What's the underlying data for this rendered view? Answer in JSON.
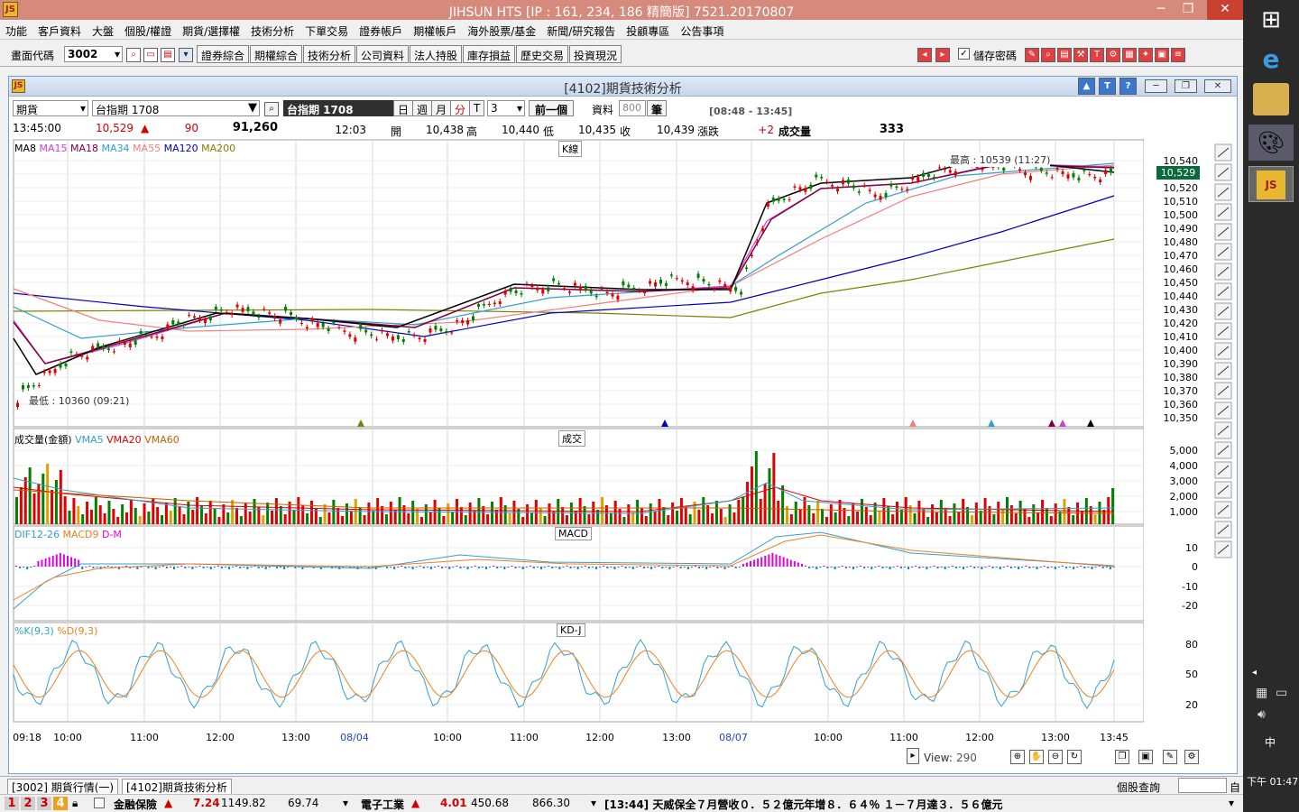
{
  "window": {
    "title": "JIHSUN HTS      [IP : 161, 234, 186 精簡版] 7521.20170807"
  },
  "menu": [
    "功能",
    "客戶資料",
    "大盤",
    "個股/權證",
    "期貨/選擇權",
    "技術分析",
    "下單交易",
    "證券帳戶",
    "期權帳戶",
    "海外股票/基金",
    "新聞/研究報告",
    "投顧專區",
    "公告事項"
  ],
  "toolbar": {
    "code_label": "畫面代碼",
    "code_value": "3002",
    "buttons": [
      "證券綜合",
      "期權綜合",
      "技術分析",
      "公司資料",
      "法人持股",
      "庫存損益",
      "歷史交易",
      "投資現況"
    ],
    "save_pw_label": "儲存密碼"
  },
  "mdi": {
    "title": "[4102]期貨技術分析",
    "type_select": "期貨",
    "symbol_select": "台指期 1708",
    "symbol_name": "台指期 1708",
    "periods": [
      "日",
      "週",
      "月",
      "分",
      "T"
    ],
    "interval": "3",
    "prev_label": "前一個",
    "data_label": "資料",
    "data_count": "800",
    "bars_label": "筆",
    "session_range": "[08:48 - 13:45]"
  },
  "quote": {
    "time": "13:45:00",
    "last": "10,529",
    "change": "90",
    "volume": "91,260",
    "bar_time": "12:03",
    "open_label": "開",
    "open": "10,438",
    "high_label": "高",
    "high": "10,440",
    "low_label": "低",
    "low": "10,435",
    "close_label": "收",
    "close": "10,439",
    "chg_label": "漲跌",
    "chg": "+2",
    "vol_label": "成交量",
    "vol": "333"
  },
  "panels": {
    "k": {
      "tag": "K線",
      "legend": [
        {
          "name": "MA8",
          "color": "#000000"
        },
        {
          "name": "MA15",
          "color": "#d040d0"
        },
        {
          "name": "MA18",
          "color": "#800040"
        },
        {
          "name": "MA34",
          "color": "#30a0d0"
        },
        {
          "name": "MA55",
          "color": "#f08080"
        },
        {
          "name": "MA120",
          "color": "#0000c0"
        },
        {
          "name": "MA200",
          "color": "#808000"
        }
      ],
      "high_note": "最高 : 10539 (11:27)",
      "low_note": "最低 : 10360 (09:21)",
      "last_badge": "10,529"
    },
    "vol": {
      "tag": "成交",
      "legend": [
        {
          "name": "成交量(金額)",
          "color": "#000000"
        },
        {
          "name": "VMA5",
          "color": "#30a0d0"
        },
        {
          "name": "VMA20",
          "color": "#e00000"
        },
        {
          "name": "VMA60",
          "color": "#c06000"
        }
      ]
    },
    "macd": {
      "tag": "MACD",
      "legend": [
        {
          "name": "DIF12-26",
          "color": "#30a0d0"
        },
        {
          "name": "MACD9",
          "color": "#f08020"
        },
        {
          "name": "D-M",
          "color": "#e000e0"
        }
      ]
    },
    "kd": {
      "tag": "KD-J",
      "legend": [
        {
          "name": "%K(9,3)",
          "color": "#30a0d0"
        },
        {
          "name": "%D(9,3)",
          "color": "#f08020"
        }
      ]
    }
  },
  "chart_data": [
    {
      "type": "line",
      "title": "K線",
      "yticks": [
        10540,
        10530,
        10520,
        10510,
        10500,
        10490,
        10480,
        10470,
        10460,
        10450,
        10440,
        10430,
        10420,
        10410,
        10400,
        10390,
        10380,
        10370,
        10360,
        10350
      ],
      "ylim": [
        10346,
        10550
      ],
      "series": [
        {
          "name": "MA8"
        },
        {
          "name": "MA15"
        },
        {
          "name": "MA18"
        },
        {
          "name": "MA34"
        },
        {
          "name": "MA55"
        },
        {
          "name": "MA120"
        },
        {
          "name": "MA200"
        }
      ],
      "candles_approx": [
        10365,
        10380,
        10395,
        10400,
        10405,
        10410,
        10420,
        10425,
        10430,
        10428,
        10425,
        10420,
        10415,
        10412,
        10410,
        10410,
        10415,
        10425,
        10440,
        10445,
        10448,
        10445,
        10442,
        10445,
        10450,
        10452,
        10448,
        10445,
        10505,
        10518,
        10525,
        10522,
        10515,
        10520,
        10530,
        10535,
        10538,
        10535,
        10532,
        10530,
        10529
      ]
    },
    {
      "type": "bar",
      "title": "成交",
      "yticks": [
        "5,000",
        "4,000",
        "3,000",
        "2,000",
        "1,000"
      ]
    },
    {
      "type": "line",
      "title": "MACD",
      "yticks": [
        "10",
        "0",
        "-10",
        "-20"
      ]
    },
    {
      "type": "line",
      "title": "KD-J",
      "yticks": [
        "80",
        "50",
        "20"
      ]
    }
  ],
  "xaxis": [
    "09:18",
    "10:00",
    "11:00",
    "12:00",
    "13:00",
    "08/04",
    "10:00",
    "11:00",
    "12:00",
    "13:00",
    "08/07",
    "10:00",
    "11:00",
    "12:00",
    "13:00",
    "13:45"
  ],
  "view": {
    "label": "View:",
    "value": "290"
  },
  "tabs": [
    "[3002] 期貨行情(一)",
    "[4102]期貨技術分析"
  ],
  "status": {
    "label": "個股查詢"
  },
  "ticker": {
    "pages": [
      "1",
      "2",
      "3",
      "4"
    ],
    "item1_name": "金融保險",
    "item1_chg": "7.24",
    "item1_val": "1149.82",
    "item1_vol": "69.74",
    "item2_name": "電子工業",
    "item2_chg": "4.01",
    "item2_val": "450.68",
    "item2_vol": "866.30",
    "news": "[13:44] 天威保全７月營收０．５２億元年增８．６４％ １－７月達３．５６億元"
  },
  "taskbar": {
    "time": "下午 01:47"
  }
}
